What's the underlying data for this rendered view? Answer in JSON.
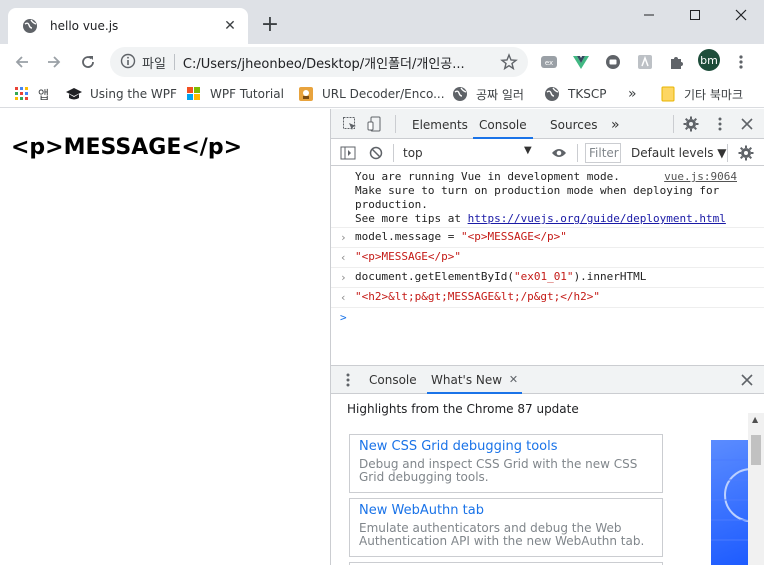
{
  "browser": {
    "tab_title": "hello vue.js",
    "new_tab": "+",
    "scheme_label": "파일",
    "url": "C:/Users/jheonbeo/Desktop/개인폴더/개인공...",
    "avatar_initials": "bm"
  },
  "bookmarks": {
    "apps": "앱",
    "items": [
      "Using the WPF",
      "WPF Tutorial",
      "URL Decoder/Enco...",
      "공짜 일러",
      "TKSCP"
    ],
    "more": "»",
    "other": "기타 북마크"
  },
  "page": {
    "heading": "<p>MESSAGE</p>"
  },
  "devtools": {
    "tabs": [
      "Elements",
      "Console",
      "Sources"
    ],
    "more_tabs": "»",
    "context": "top",
    "filter_placeholder": "Filter",
    "levels": "Default levels ▼",
    "console": {
      "vue_msg_1": "You are running Vue in development mode.",
      "vue_src": "vue.js:9064",
      "vue_msg_2": "Make sure to turn on production mode when deploying for",
      "vue_msg_3": "production.",
      "vue_msg_4_prefix": "See more tips at ",
      "vue_msg_4_link": "https://vuejs.org/guide/deployment.html",
      "in1_prefix": "model.message = ",
      "in1_str": "\"<p>MESSAGE</p>\"",
      "out1": "\"<p>MESSAGE</p>\"",
      "in2_prefix": "document.getElementById(",
      "in2_str": "\"ex01_01\"",
      "in2_suffix": ").innerHTML",
      "out2": "\"<h2>&lt;p&gt;MESSAGE&lt;/p&gt;</h2>\"",
      "prompt": ">"
    },
    "drawer": {
      "tabs": [
        "Console",
        "What's New"
      ],
      "heading": "Highlights from the Chrome 87 update",
      "cards": [
        {
          "title": "New CSS Grid debugging tools",
          "desc": "Debug and inspect CSS Grid with the new CSS Grid debugging tools."
        },
        {
          "title": "New WebAuthn tab",
          "desc": "Emulate authenticators and debug the Web Authentication API with the new WebAuthn tab."
        }
      ]
    }
  },
  "colors": {
    "accent": "#1a73e8",
    "string": "#c41a16",
    "vue_green": "#41b883"
  }
}
